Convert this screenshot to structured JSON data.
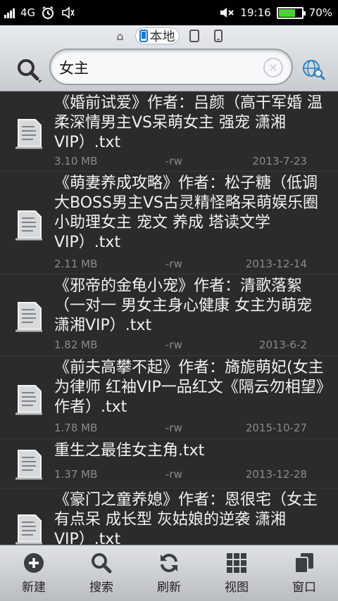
{
  "status_bar": {
    "network": "4G",
    "time": "19:16",
    "battery_percent": "70%",
    "battery_level": 0.7
  },
  "header": {
    "tabs": [
      {
        "icon": "home-icon",
        "label": ""
      },
      {
        "icon": "phone-icon",
        "label": "本地"
      },
      {
        "icon": "tablet-icon",
        "label": ""
      },
      {
        "icon": "device-icon",
        "label": ""
      }
    ],
    "search_value": "女主"
  },
  "files": [
    {
      "title": "《婚前试爱》作者：吕颜（高干军婚 温柔深情男主VS呆萌女主 强宠 潇湘VIP）.txt",
      "size": "3.10 MB",
      "perm": "-rw",
      "date": "2013-7-23"
    },
    {
      "title": "《萌妻养成攻略》作者：松子糖（低调大BOSS男主VS古灵精怪略呆萌娱乐圈小助理女主 宠文 养成 塔读文学VIP）.txt",
      "size": "2.11 MB",
      "perm": "-rw",
      "date": "2013-12-14"
    },
    {
      "title": "《邪帝的金龟小宠》作者：清歌落絮（一对一 男女主身心健康 女主为萌宠 潇湘VIP）.txt",
      "size": "1.82 MB",
      "perm": "-rw",
      "date": "2013-6-2"
    },
    {
      "title": "《前夫高攀不起》作者：旖旎萌妃(女主为律师 红袖VIP一品红文《隔云勿相望》作者）.txt",
      "size": "1.78 MB",
      "perm": "-rw",
      "date": "2015-10-27"
    },
    {
      "title": "重生之最佳女主角.txt",
      "size": "1.37 MB",
      "perm": "-rw",
      "date": "2013-12-28"
    },
    {
      "title": "《豪门之童养媳》作者：恩很宅（女主有点呆 成长型 灰姑娘的逆袭 潇湘VIP）.txt",
      "size": "",
      "perm": "",
      "date": ""
    }
  ],
  "toolbar": [
    {
      "label": "新建",
      "icon": "plus-circle-icon"
    },
    {
      "label": "搜索",
      "icon": "search-icon"
    },
    {
      "label": "刷新",
      "icon": "refresh-icon"
    },
    {
      "label": "视图",
      "icon": "grid-icon"
    },
    {
      "label": "窗口",
      "icon": "windows-icon"
    }
  ]
}
